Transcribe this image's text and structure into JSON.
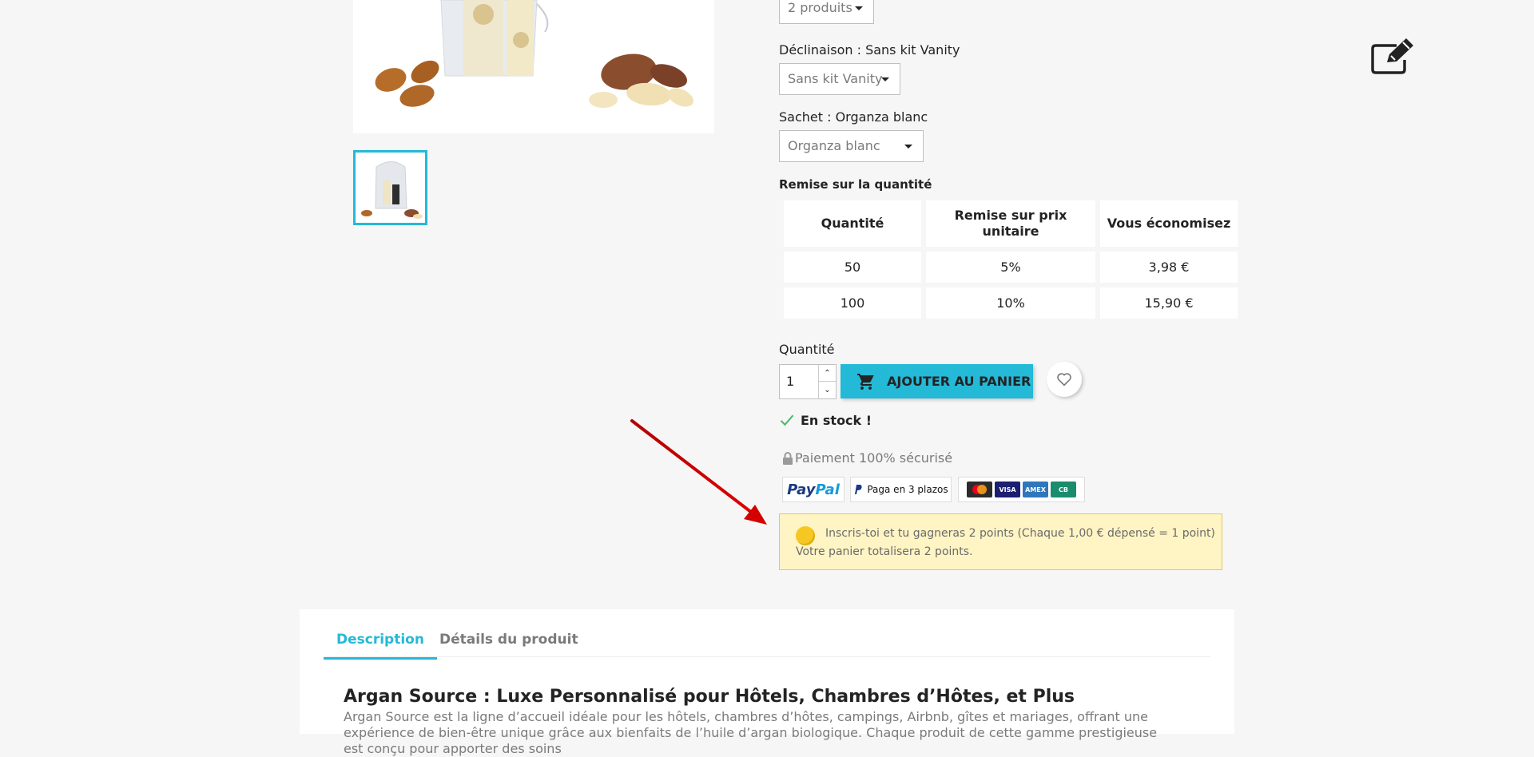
{
  "options": {
    "pack_select": {
      "value": "2 produits"
    },
    "declinaison": {
      "label": "Déclinaison : Sans kit Vanity",
      "value": "Sans kit Vanity"
    },
    "sachet": {
      "label": "Sachet : Organza blanc",
      "value": "Organza blanc"
    }
  },
  "discount": {
    "heading": "Remise sur la quantité",
    "headers": [
      "Quantité",
      "Remise sur prix unitaire",
      "Vous économisez"
    ],
    "rows": [
      [
        "50",
        "5%",
        "3,98 €"
      ],
      [
        "100",
        "10%",
        "15,90 €"
      ]
    ]
  },
  "quantity": {
    "label": "Quantité",
    "value": "1"
  },
  "add_to_cart": {
    "label": "Ajouter au panier"
  },
  "stock": {
    "text": "En stock !",
    "color": "#4cbb6c"
  },
  "secure_payment": {
    "text": "Paiement 100% sécurisé"
  },
  "payment": {
    "paypal_a": "Pay",
    "paypal_b": "Pal",
    "paga": "Paga en 3 plazos",
    "cards": [
      "mastercard",
      "VISA",
      "AMEX",
      "CB"
    ]
  },
  "loyalty": {
    "line1": "Inscris-toi et tu gagneras 2 points (Chaque 1,00 € dépensé = 1 point)",
    "line2": "Votre panier totalisera 2 points."
  },
  "tabs": {
    "description": "Description",
    "details": "Détails du produit"
  },
  "description": {
    "title": "Argan Source : Luxe Personnalisé pour Hôtels, Chambres d’Hôtes, et Plus",
    "text": "Argan Source est la ligne d’accueil idéale pour les hôtels, chambres d’hôtes, campings, Airbnb, gîtes et mariages, offrant une expérience de bien-être unique grâce aux bienfaits de l’huile d’argan biologique. Chaque produit de cette gamme prestigieuse est conçu pour apporter des soins"
  },
  "colors": {
    "accent": "#24b9d7",
    "arrow": "#d40000"
  }
}
